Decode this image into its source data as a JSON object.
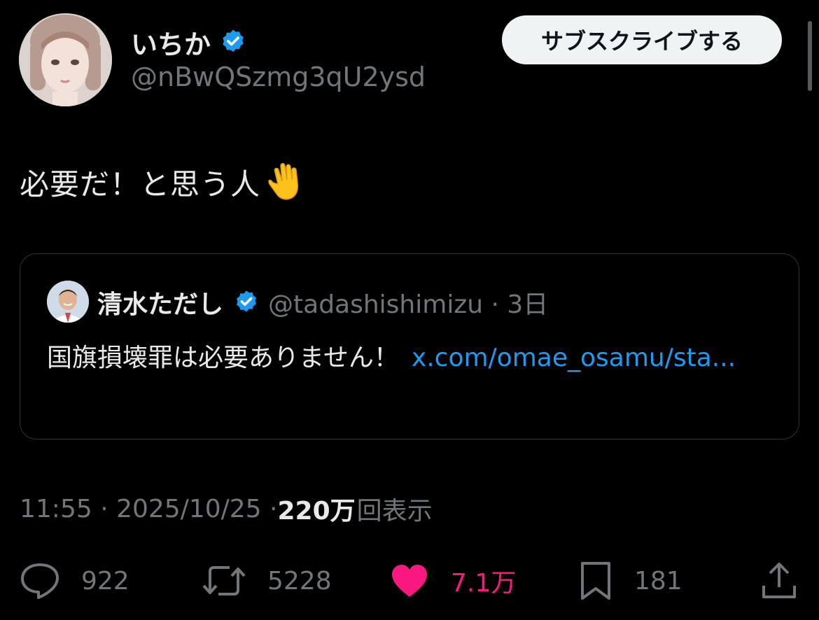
{
  "author": {
    "display_name": "いちか",
    "handle": "@nBwQSzmg3qU2ysd",
    "verified": true,
    "avatar": "profile-photo"
  },
  "subscribe_button": {
    "label": "サブスクライブする"
  },
  "tweet": {
    "text": "必要だ！と思う人",
    "emoji": "raised-hand-emoji"
  },
  "quote": {
    "display_name": "清水ただし",
    "handle_time": "@tadashishimizu · 3日",
    "verified": true,
    "text": "国旗損壊罪は必要ありません！",
    "link": "x.com/omae_osamu/sta..."
  },
  "meta": {
    "time": "11:55 · 2025/10/25 · ",
    "views_count": "220万",
    "views_label": "回表示"
  },
  "actions": {
    "replies": "922",
    "retweets": "5228",
    "likes": "7.1万",
    "bookmarks": "181"
  },
  "colors": {
    "background": "#000000",
    "text": "#e7e9ea",
    "secondary": "#71767b",
    "link": "#1d9bf0",
    "like": "#f91880",
    "verified": "#1d9bf0"
  }
}
